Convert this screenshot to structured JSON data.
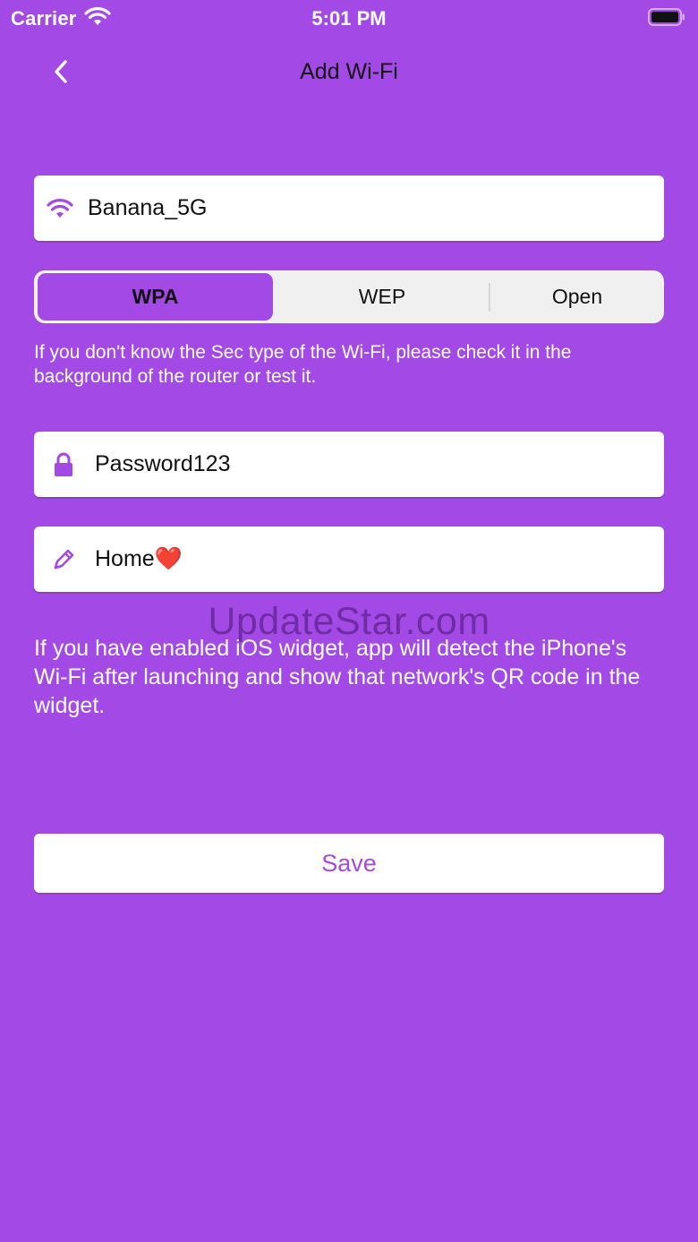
{
  "status_bar": {
    "carrier": "Carrier",
    "time": "5:01 PM"
  },
  "nav": {
    "title": "Add Wi-Fi",
    "back_icon": "chevron-left-icon"
  },
  "network": {
    "ssid_value": "Banana_5G",
    "icon": "wifi-icon"
  },
  "security": {
    "options": [
      "WPA",
      "WEP",
      "Open"
    ],
    "selected": "WPA",
    "hint": "If you don't know the Sec type of the Wi-Fi, please check it in the background of the router or test it."
  },
  "password": {
    "value": "Password123",
    "icon": "lock-icon"
  },
  "name": {
    "value": "Home❤️",
    "icon": "pencil-icon"
  },
  "watermark": "UpdateStar.com",
  "widget_hint": "If you have enabled iOS widget, app will detect the iPhone's Wi-Fi after launching and show that network's QR code in the widget.",
  "save_label": "Save",
  "colors": {
    "background": "#a34ae6",
    "accent": "#a34ae6",
    "field_bg": "#ffffff",
    "segment_bg": "#f0f0f0"
  }
}
